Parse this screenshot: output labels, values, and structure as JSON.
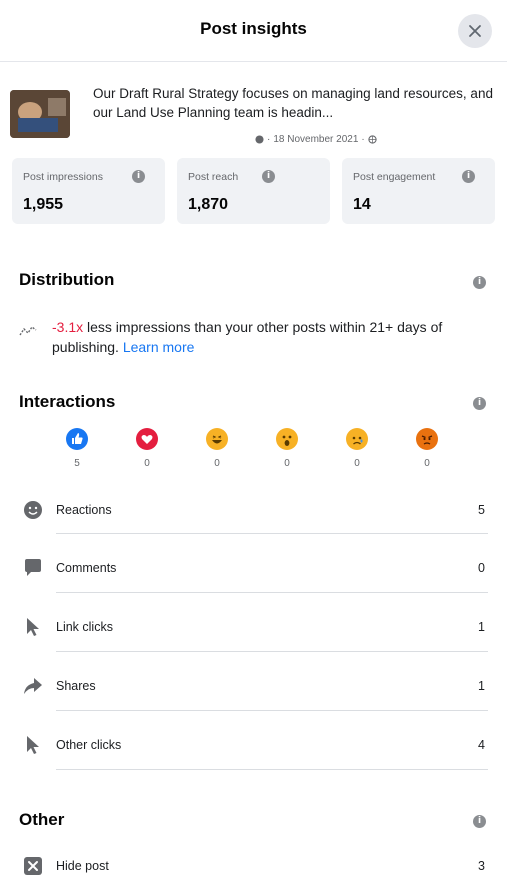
{
  "header": {
    "title": "Post insights"
  },
  "post": {
    "text": "Our Draft Rural Strategy focuses on managing land resources, and our Land Use Planning team is headin...",
    "date": "18 November 2021"
  },
  "stats": [
    {
      "label": "Post impressions",
      "value": "1,955"
    },
    {
      "label": "Post reach",
      "value": "1,870"
    },
    {
      "label": "Post engagement",
      "value": "14"
    }
  ],
  "distribution": {
    "title": "Distribution",
    "highlight": "-3.1x",
    "text": " less impressions than your other posts within 21+ days of publishing. ",
    "link": "Learn more"
  },
  "interactions": {
    "title": "Interactions",
    "reactions": [
      {
        "name": "like",
        "count": "5"
      },
      {
        "name": "love",
        "count": "0"
      },
      {
        "name": "haha",
        "count": "0"
      },
      {
        "name": "wow",
        "count": "0"
      },
      {
        "name": "sad",
        "count": "0"
      },
      {
        "name": "angry",
        "count": "0"
      }
    ],
    "rows": [
      {
        "label": "Reactions",
        "value": "5",
        "icon": "smiley-icon"
      },
      {
        "label": "Comments",
        "value": "0",
        "icon": "comment-icon"
      },
      {
        "label": "Link clicks",
        "value": "1",
        "icon": "cursor-icon"
      },
      {
        "label": "Shares",
        "value": "1",
        "icon": "share-icon"
      },
      {
        "label": "Other clicks",
        "value": "4",
        "icon": "cursor-icon"
      }
    ]
  },
  "other": {
    "title": "Other",
    "rows": [
      {
        "label": "Hide post",
        "value": "3",
        "icon": "hide-icon"
      }
    ]
  },
  "colors": {
    "accent": "#1877f2",
    "negative": "#e41e3f",
    "like": "#1877f2",
    "love": "#e41e3f",
    "emoji_yellow": "#f7b125",
    "angry": "#e9710f"
  }
}
